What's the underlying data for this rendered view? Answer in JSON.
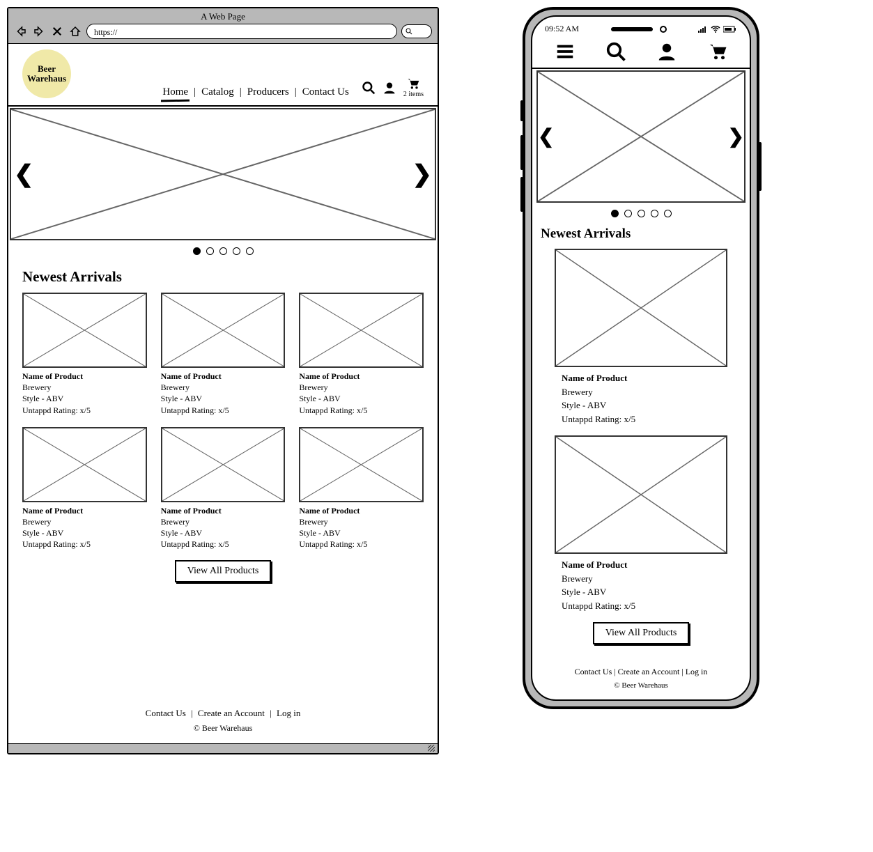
{
  "browser": {
    "title": "A Web Page",
    "url": "https://"
  },
  "logo_text": "Beer Warehaus",
  "nav": {
    "home": "Home",
    "catalog": "Catalog",
    "producers": "Producers",
    "contact": "Contact Us"
  },
  "cart_count": "2 items",
  "section_title_desktop": "Newest Arrivals",
  "section_title_mobile": "Newest Arrivals",
  "product": {
    "name": "Name of Product",
    "brewery": "Brewery",
    "style": "Style - ABV",
    "rating": "Untappd Rating: x/5"
  },
  "view_all": "View All Products",
  "footer": {
    "contact": "Contact Us",
    "create": "Create an Account",
    "login": "Log in",
    "copy": "© Beer Warehaus"
  },
  "phone": {
    "time": "09:52 AM"
  }
}
